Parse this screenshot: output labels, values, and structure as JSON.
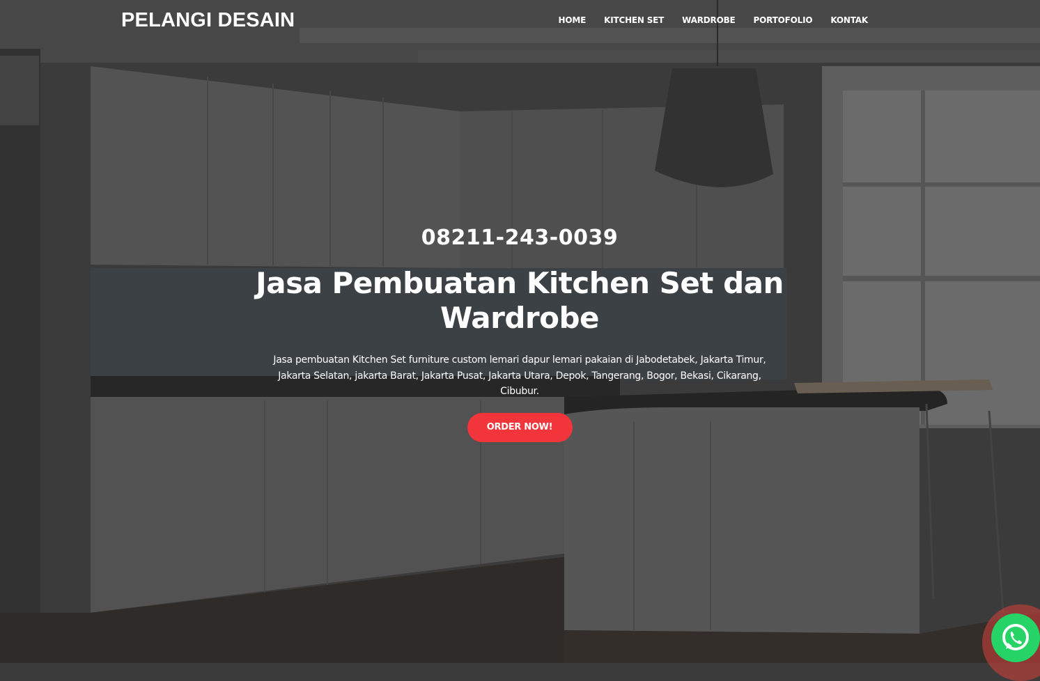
{
  "brand": "PELANGI DESAIN",
  "nav": [
    "HOME",
    "KITCHEN SET",
    "WARDROBE",
    "PORTOFOLIO",
    "KONTAK"
  ],
  "hero": {
    "phone": "08211-243-0039",
    "title": "Jasa Pembuatan Kitchen Set dan Wardrobe",
    "description": "Jasa pembuatan Kitchen Set furniture custom lemari dapur lemari pakaian di Jabodetabek, Jakarta Timur, Jakarta Selatan, jakarta Barat, Jakarta Pusat, Jakarta Utara, Depok, Tangerang, Bogor, Bekasi, Cikarang, Cibubur.",
    "cta": "ORDER NOW!"
  },
  "colors": {
    "accent": "#f2353a",
    "whatsapp": "#25d366",
    "ring": "#d9423a"
  },
  "icons": {
    "whatsapp": "whatsapp-icon"
  }
}
